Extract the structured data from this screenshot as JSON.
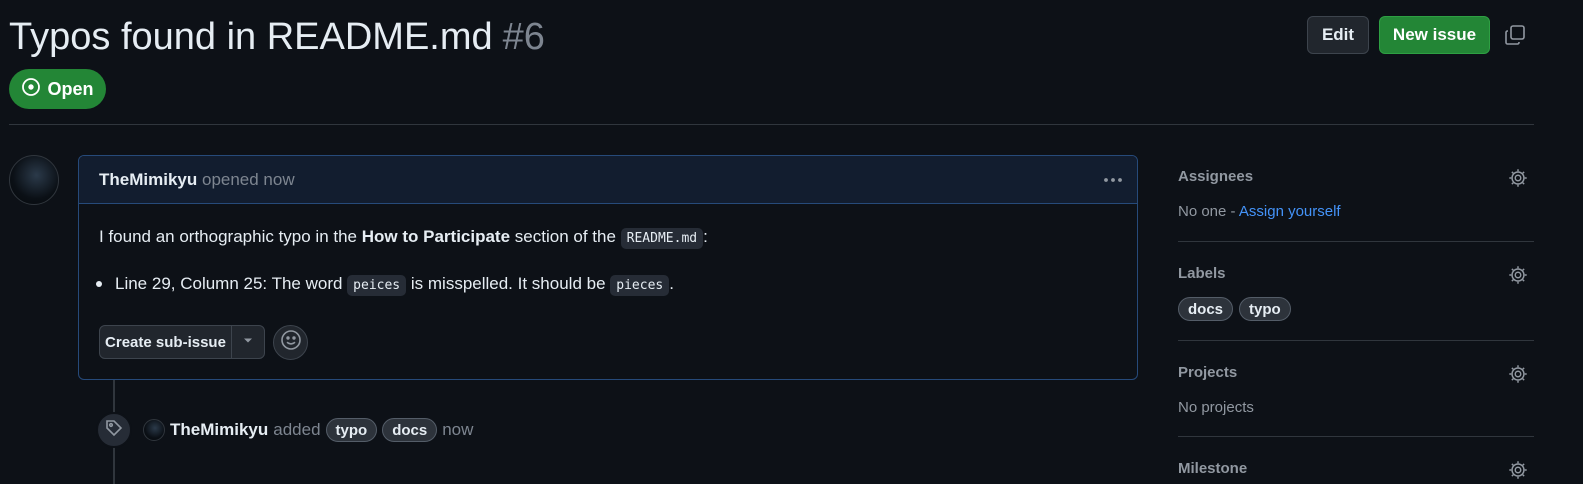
{
  "issue": {
    "title": "Typos found in README.md",
    "number": "#6",
    "state": "Open"
  },
  "header_actions": {
    "edit_label": "Edit",
    "new_issue_label": "New issue"
  },
  "comment": {
    "author": "TheMimikyu",
    "action": "opened now",
    "intro_before": "I found an orthographic typo in the",
    "intro_bold": "How to Participate",
    "intro_after": "section of the",
    "intro_code": "README.md",
    "intro_end": ":",
    "bullet_before": "Line 29, Column 25: The word",
    "bullet_code_wrong": "peices",
    "bullet_middle": "is misspelled. It should be",
    "bullet_code_right": "pieces",
    "bullet_end": ".",
    "create_subissue_label": "Create sub-issue"
  },
  "timeline_event": {
    "actor": "TheMimikyu",
    "action": "added",
    "labels": [
      "typo",
      "docs"
    ],
    "time": "now"
  },
  "sidebar": {
    "assignees": {
      "heading": "Assignees",
      "text": "No one -",
      "link": "Assign yourself"
    },
    "labels": {
      "heading": "Labels",
      "items": [
        "docs",
        "typo"
      ]
    },
    "projects": {
      "heading": "Projects",
      "text": "No projects"
    },
    "milestone": {
      "heading": "Milestone"
    }
  },
  "colors": {
    "background": "#0d1117",
    "open_green": "#238636",
    "link_blue": "#4493f8",
    "muted": "#7d8590"
  },
  "icons": [
    "copy-icon",
    "issue-open-icon",
    "kebab-icon",
    "chevron-down-icon",
    "smiley-icon",
    "tag-icon",
    "gear-icon"
  ]
}
